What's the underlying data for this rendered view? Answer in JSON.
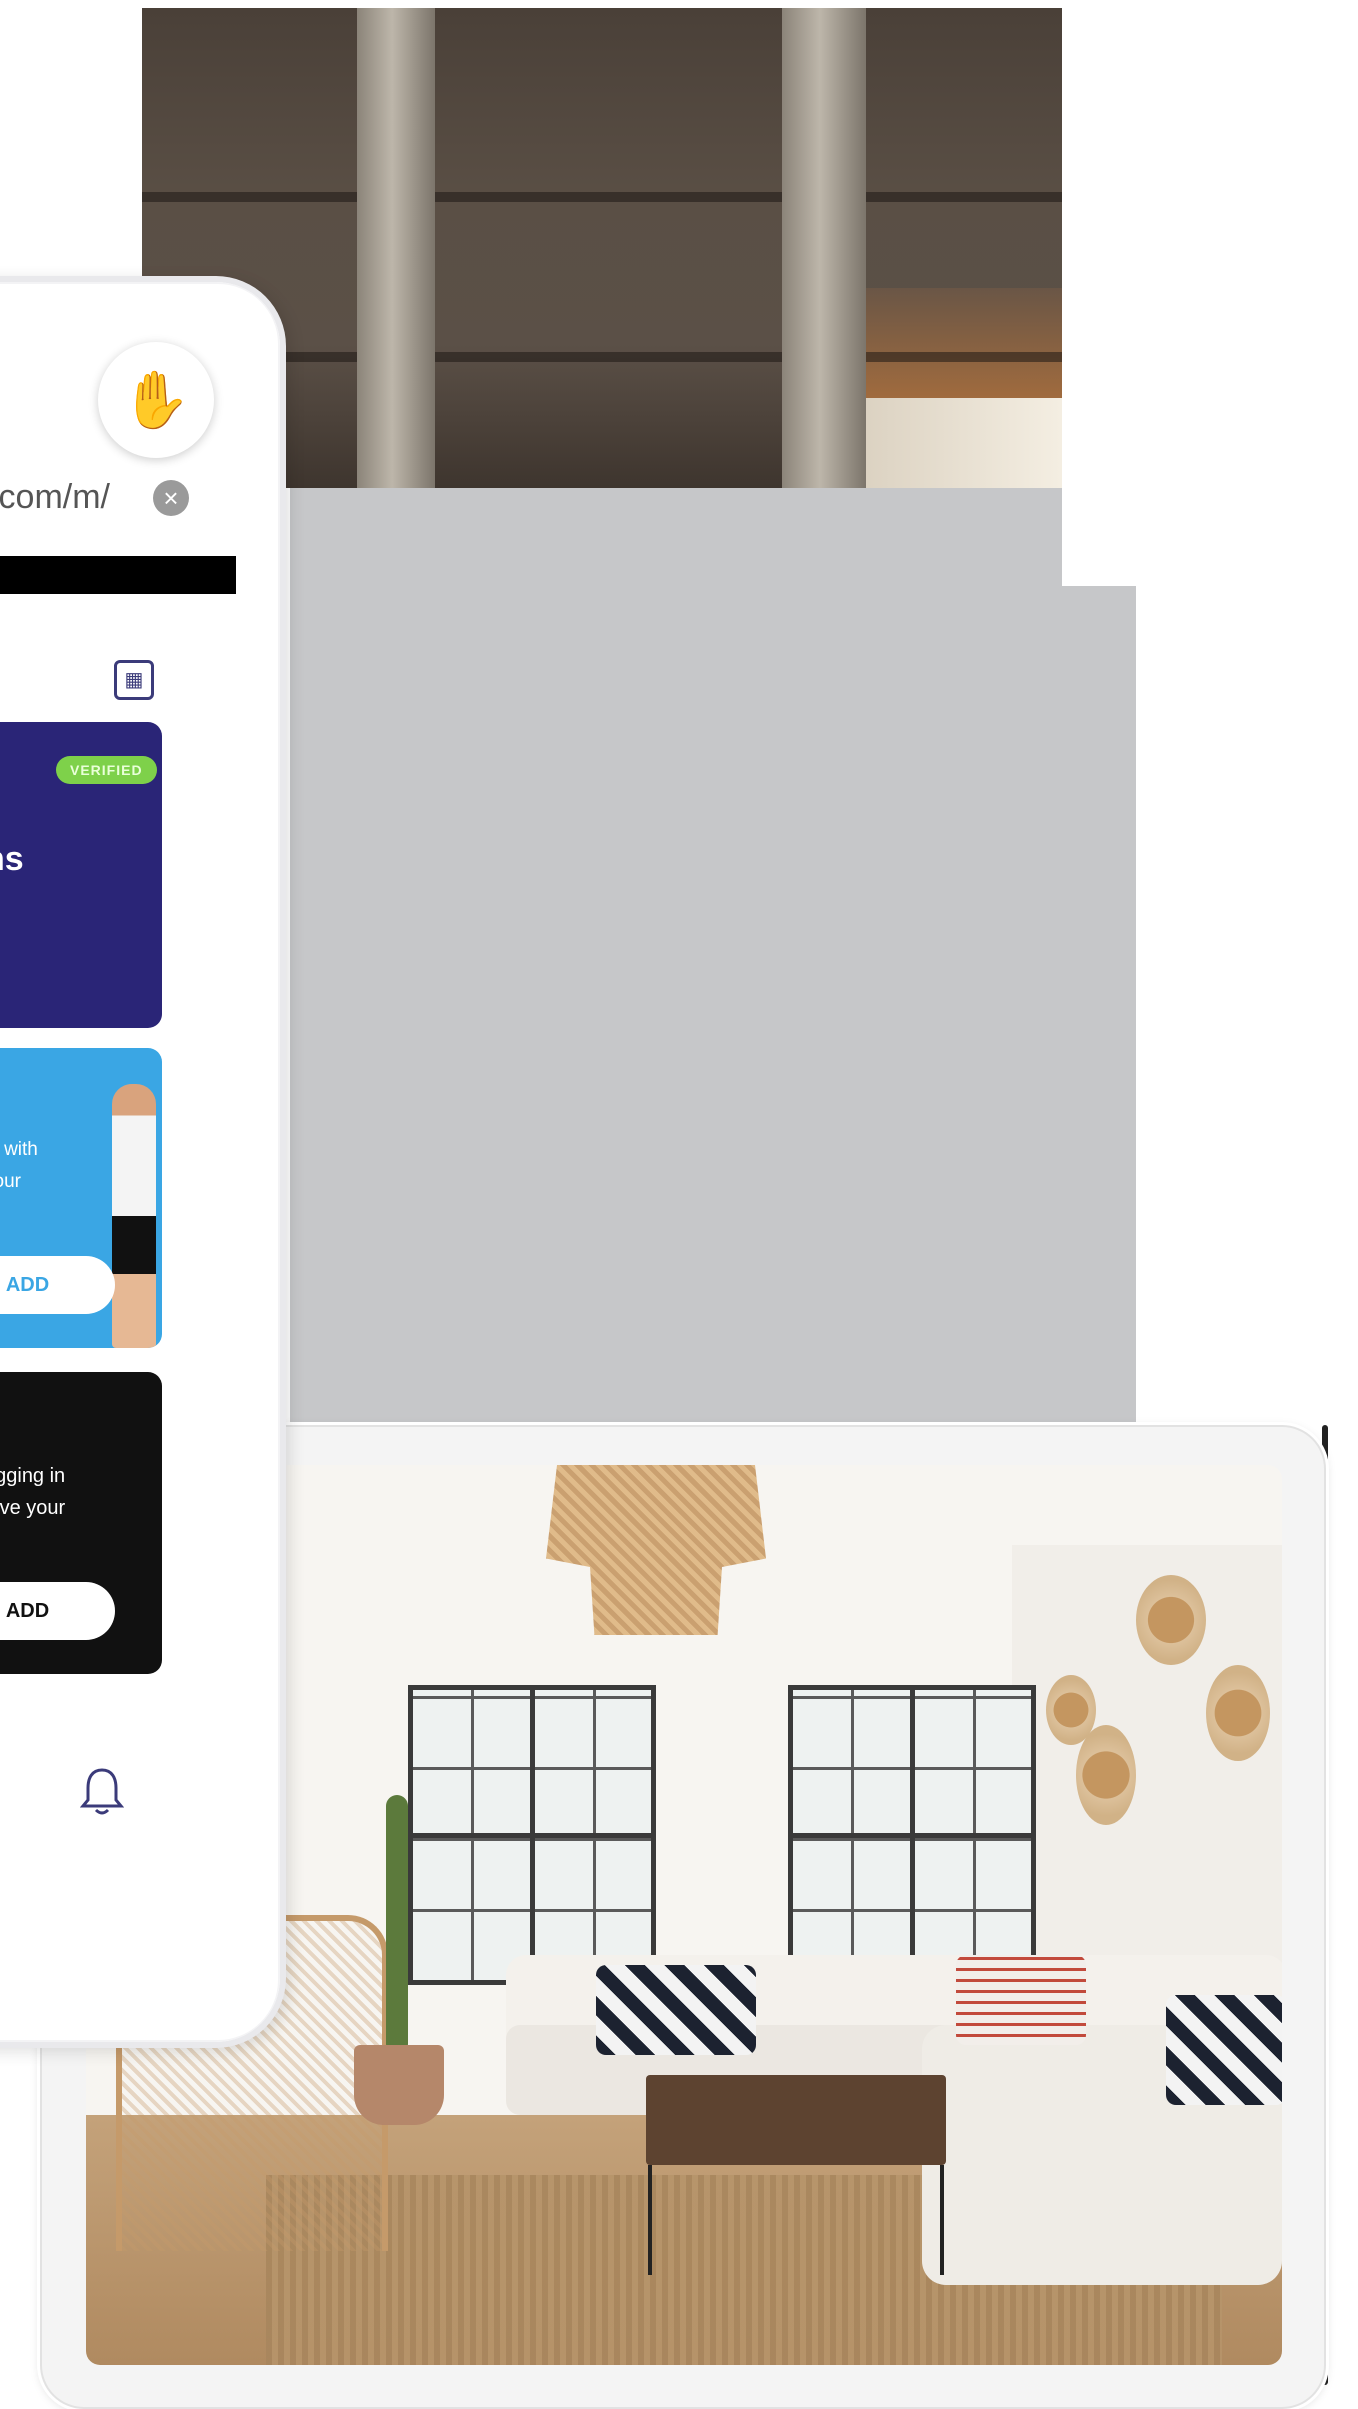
{
  "phone": {
    "url_fragment": "com/m/",
    "url_close": "×",
    "cards": {
      "verified_badge": "VERIFIED",
      "purple_title": "ns",
      "blue_text_line1": "in with",
      "blue_text_line2": "your",
      "blue_add_label": "ADD",
      "black_text_line1": "ogging in",
      "black_text_line2": "eive your",
      "black_add_label": "ADD"
    },
    "icons": {
      "hand": "✋",
      "qr": "▦",
      "bell": "🔔"
    },
    "colors": {
      "purple_card": "#2a2577",
      "blue_card": "#3aa6e4",
      "black_card": "#111111",
      "verified": "#7ed14a",
      "hand_accent": "#e6c200"
    }
  }
}
